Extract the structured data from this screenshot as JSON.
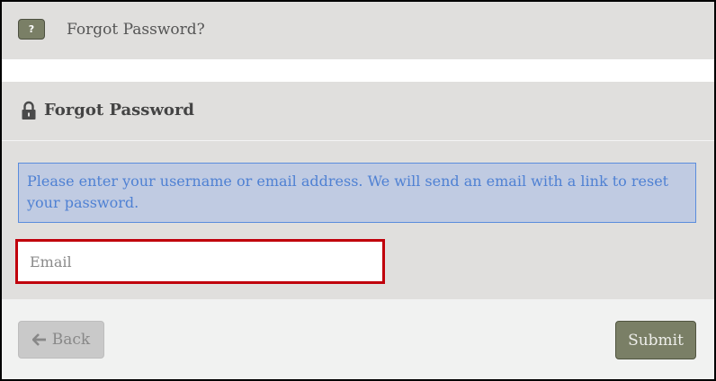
{
  "help": {
    "button_glyph": "?",
    "label": "Forgot Password?"
  },
  "panel": {
    "title": "Forgot Password",
    "icon": "lock-icon",
    "message": "Please enter your username or email address. We will send an email with a link to reset your password.",
    "email_placeholder": "Email",
    "email_value": ""
  },
  "footer": {
    "back_label": "Back",
    "back_icon": "arrow-left-icon",
    "submit_label": "Submit"
  },
  "colors": {
    "accent_button": "#7a7f66",
    "alert_background": "#c0cbe2",
    "alert_text": "#4f81d3",
    "error_border": "#c0000b"
  }
}
